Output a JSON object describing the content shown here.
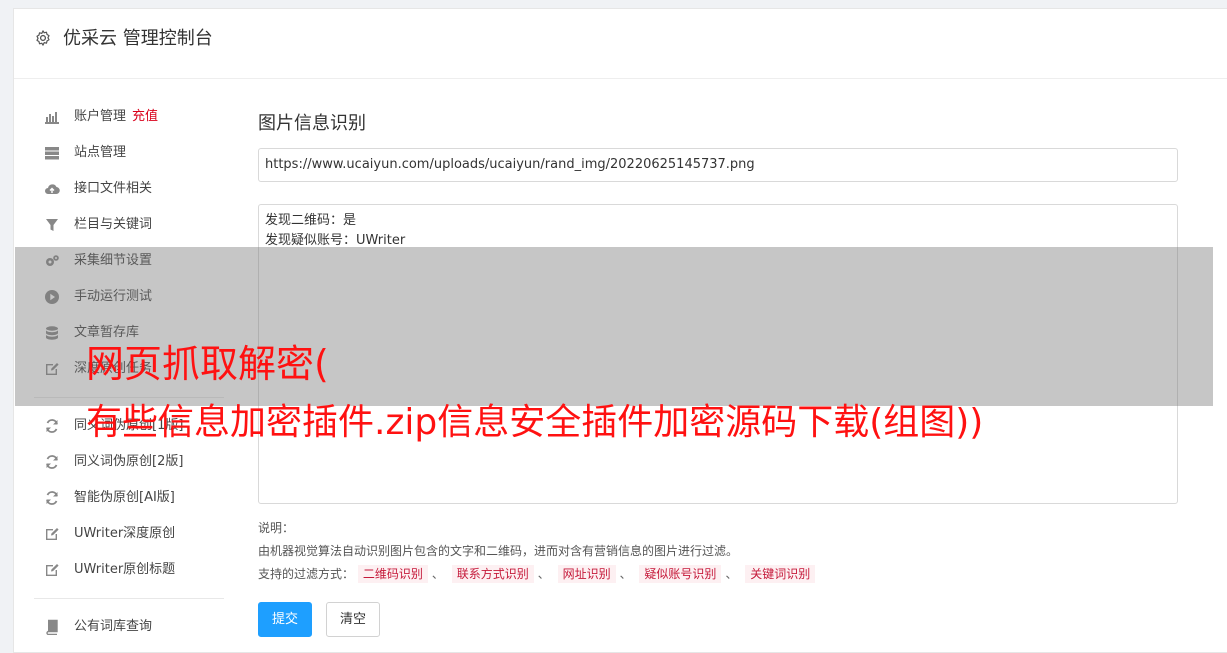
{
  "header": {
    "title": "优采云 管理控制台",
    "icon": "gear-icon"
  },
  "sidebar": {
    "items": [
      {
        "label": "账户管理",
        "extra": "充值",
        "icon": "bar-chart-icon"
      },
      {
        "label": "站点管理",
        "icon": "server-icon"
      },
      {
        "label": "接口文件相关",
        "icon": "cloud-upload-icon"
      },
      {
        "label": "栏目与关键词",
        "icon": "filter-icon"
      },
      {
        "label": "采集细节设置",
        "icon": "gears-icon"
      },
      {
        "label": "手动运行测试",
        "icon": "play-circle-icon"
      },
      {
        "label": "文章暂存库",
        "icon": "database-icon"
      },
      {
        "label": "深度原创任务",
        "icon": "edit-icon"
      },
      {
        "label": "同义词伪原创[1版]",
        "icon": "refresh-icon"
      },
      {
        "label": "同义词伪原创[2版]",
        "icon": "refresh-icon"
      },
      {
        "label": "智能伪原创[AI版]",
        "icon": "refresh-icon"
      },
      {
        "label": "UWriter深度原创",
        "icon": "edit-icon"
      },
      {
        "label": "UWriter原创标题",
        "icon": "edit-icon"
      },
      {
        "label": "公有词库查询",
        "icon": "book-icon"
      }
    ]
  },
  "main": {
    "title": "图片信息识别",
    "url_value": "https://www.ucaiyun.com/uploads/ucaiyun/rand_img/20220625145737.png",
    "result_lines": [
      "发现二维码：是",
      "发现疑似账号：UWriter"
    ],
    "notes_label": "说明：",
    "notes_desc": "由机器视觉算法自动识别图片包含的文字和二维码，进而对含有营销信息的图片进行过滤。",
    "filter_label": "支持的过滤方式：",
    "filter_tags": [
      "二维码识别",
      "联系方式识别",
      "网址识别",
      "疑似账号识别",
      "关键词识别"
    ],
    "separator": "、",
    "submit_label": "提交",
    "clear_label": "清空"
  },
  "overlay": {
    "line1": "网页抓取解密(",
    "line2": "有些信息加密插件.zip信息安全插件加密源码下载(组图))"
  },
  "colors": {
    "accent": "#1e9fff",
    "recharge": "#d9001b",
    "tag_text": "#c5193a",
    "overlay_text": "#ff1111"
  }
}
